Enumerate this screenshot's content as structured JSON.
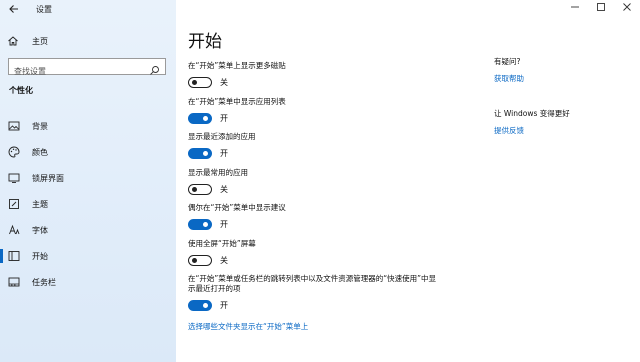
{
  "window": {
    "title": "设置",
    "back_icon": "back-arrow-icon",
    "minimize_icon": "minimize-icon",
    "maximize_icon": "maximize-icon",
    "close_icon": "close-icon"
  },
  "sidebar": {
    "home_label": "主页",
    "search_placeholder": "查找设置",
    "section_title": "个性化",
    "items": [
      {
        "label": "背景",
        "icon": "image-icon"
      },
      {
        "label": "颜色",
        "icon": "palette-icon"
      },
      {
        "label": "锁屏界面",
        "icon": "monitor-icon"
      },
      {
        "label": "主题",
        "icon": "brush-icon"
      },
      {
        "label": "字体",
        "icon": "font-icon"
      },
      {
        "label": "开始",
        "icon": "start-icon",
        "selected": true
      },
      {
        "label": "任务栏",
        "icon": "taskbar-icon"
      }
    ]
  },
  "main": {
    "title": "开始",
    "settings": [
      {
        "label": "在“开始”菜单上显示更多磁贴",
        "on": false,
        "state": "关"
      },
      {
        "label": "在“开始”菜单中显示应用列表",
        "on": true,
        "state": "开"
      },
      {
        "label": "显示最近添加的应用",
        "on": true,
        "state": "开"
      },
      {
        "label": "显示最常用的应用",
        "on": false,
        "state": "关"
      },
      {
        "label": "偶尔在“开始”菜单中显示建议",
        "on": true,
        "state": "开"
      },
      {
        "label": "使用全屏“开始”屏幕",
        "on": false,
        "state": "关"
      },
      {
        "label": "在“开始”菜单或任务栏的跳转列表中以及文件资源管理器的“快速使用”中显示最近打开的项",
        "on": true,
        "state": "开"
      }
    ],
    "choose_folders_link": "选择哪些文件夹显示在“开始”菜单上"
  },
  "right": {
    "question_heading": "有疑问?",
    "help_link": "获取帮助",
    "improve_heading": "让 Windows 变得更好",
    "feedback_link": "提供反馈"
  },
  "colors": {
    "accent": "#0a68c4",
    "sidebar_bg": "#e3eefa"
  }
}
